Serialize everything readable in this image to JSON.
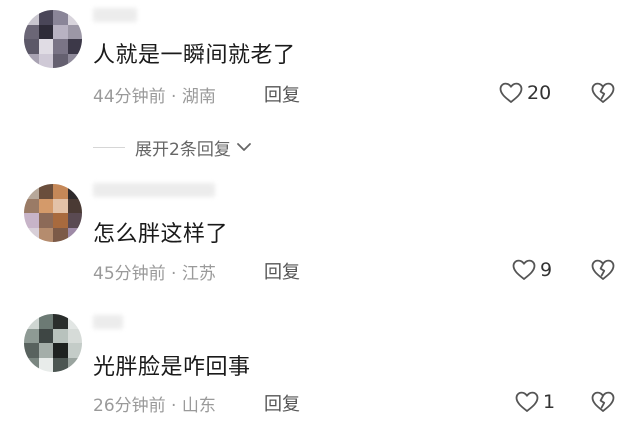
{
  "comments": [
    {
      "text": "人就是一瞬间就老了",
      "meta": "44分钟前 · 湖南",
      "reply_label": "回复",
      "like_count": "20",
      "avatar_colors": [
        "#c9c6cf",
        "#4a4658",
        "#8a8598",
        "#d8d4dc",
        "#6b6676",
        "#2e2b38",
        "#b8b2c2",
        "#9c97a6",
        "#5c5868",
        "#e0dce4",
        "#7a7486",
        "#3c3848",
        "#a8a2b2",
        "#cfc9d6",
        "#656070",
        "#8f8a9a"
      ]
    },
    {
      "text": "怎么胖这样了",
      "meta": "45分钟前 · 江苏",
      "reply_label": "回复",
      "like_count": "9",
      "avatar_colors": [
        "#b7a89a",
        "#6a4e3c",
        "#c58858",
        "#2e2a2c",
        "#9a7b66",
        "#d49a6a",
        "#e3c2a8",
        "#4a3a34",
        "#c7b4c8",
        "#8c6a58",
        "#a86a3e",
        "#5a4a52",
        "#d8cfd8",
        "#b58c6e",
        "#7c5a48",
        "#9e8aa6"
      ]
    },
    {
      "text": "光胖脸是咋回事",
      "meta": "26分钟前 · 山东",
      "reply_label": "回复",
      "like_count": "1",
      "avatar_colors": [
        "#cfd6d2",
        "#6c7a74",
        "#2a2e2c",
        "#e2e6e4",
        "#8e9a94",
        "#3e4644",
        "#b8c2bd",
        "#d6dbd8",
        "#58625e",
        "#a4aea9",
        "#1e2220",
        "#c4ccc8",
        "#7a8680",
        "#e8ecea",
        "#4c5652",
        "#9aa49f"
      ]
    }
  ],
  "expand_replies": {
    "label": "展开2条回复"
  },
  "icons": {
    "like": "heart-outline-icon",
    "dislike": "broken-heart-icon",
    "expand": "chevron-down-icon"
  },
  "colors": {
    "meta_text": "#9a9a9a",
    "reply_text": "#555555",
    "icon_stroke": "#555555"
  }
}
